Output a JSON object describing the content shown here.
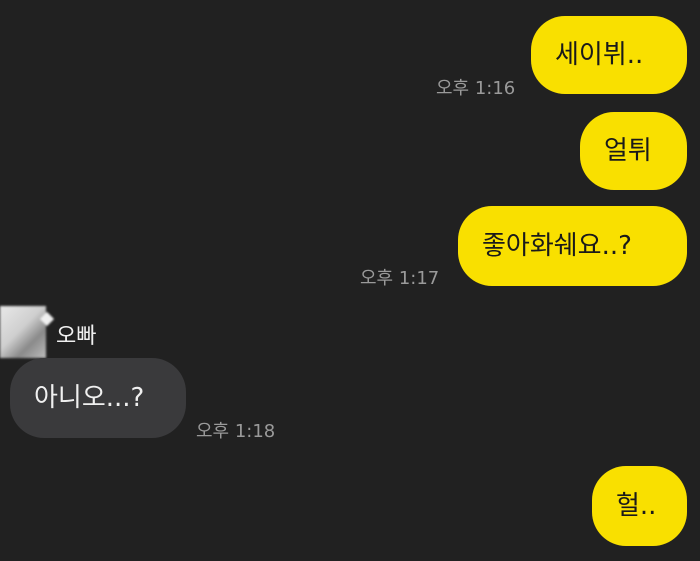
{
  "messages": [
    {
      "text": "세이뷔..",
      "time": "오후 1:16",
      "side": "mine"
    },
    {
      "text": "얼튀",
      "time": "",
      "side": "mine"
    },
    {
      "text": "좋아화쉐요..?",
      "time": "오후 1:17",
      "side": "mine"
    },
    {
      "sender": "오빠",
      "text": "아니오...?",
      "time": "오후 1:18",
      "side": "theirs"
    },
    {
      "text": "헐..",
      "time": "",
      "side": "mine"
    }
  ],
  "colors": {
    "background": "#212121",
    "my_bubble": "#f9e000",
    "their_bubble": "#3a3a3c",
    "timestamp": "#9a9a9a"
  }
}
